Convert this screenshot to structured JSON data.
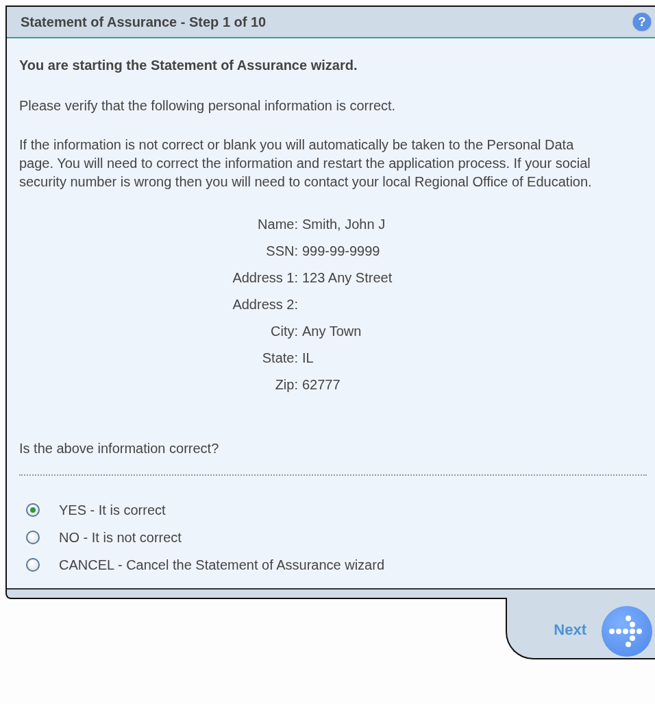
{
  "window": {
    "title": "Statement of Assurance - Step 1 of 10",
    "help_button": "?"
  },
  "heading": "You are starting the Statement of Assurance wizard.",
  "paragraphs": [
    "Please verify that the following personal information is correct.",
    "If the information is not correct or blank you will automatically be taken to the Personal Data page. You will need to correct the information and restart the application process. If your social security number is wrong then you will need to contact your local Regional Office of Education."
  ],
  "fields": [
    {
      "label": "Name:",
      "value": "Smith, John J"
    },
    {
      "label": "SSN:",
      "value": "999-99-9999"
    },
    {
      "label": "Address 1:",
      "value": "123 Any Street"
    },
    {
      "label": "Address 2:"
    },
    {
      "label": "City:",
      "value": "Any Town"
    },
    {
      "label": "State:",
      "value": "IL"
    },
    {
      "label": "Zip:",
      "value": "62777"
    }
  ],
  "question": "Is the above information correct?",
  "options": [
    {
      "label": "YES - It is correct",
      "selected": true
    },
    {
      "label": "NO - It is not correct",
      "selected": false
    },
    {
      "label": "CANCEL - Cancel the Statement of Assurance wizard",
      "selected": false
    }
  ],
  "next_button": {
    "label": "Next"
  }
}
